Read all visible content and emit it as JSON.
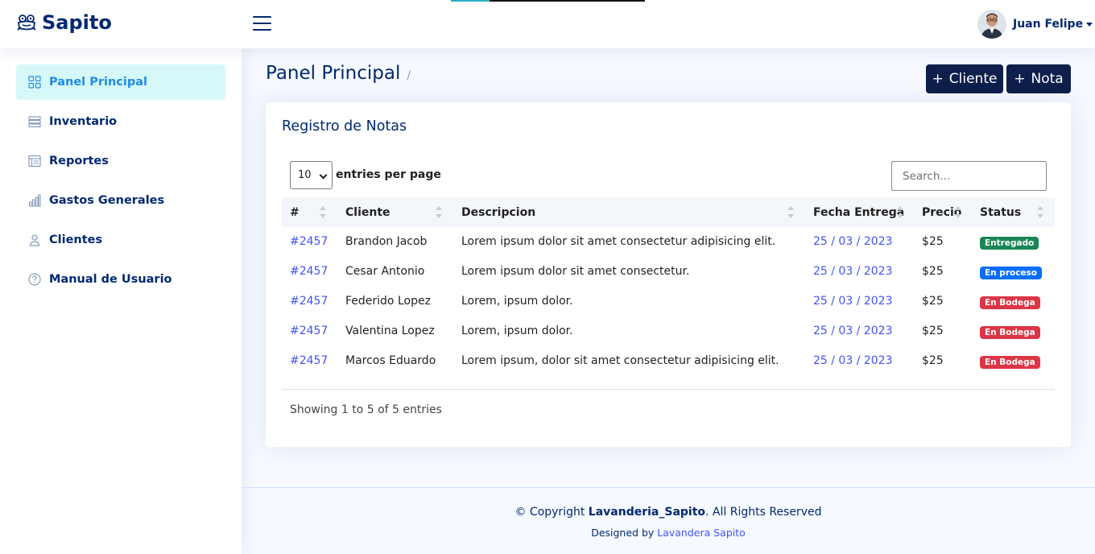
{
  "header": {
    "brand": "Sapito",
    "user_name": "Juan Felipe"
  },
  "sidebar": {
    "items": [
      {
        "label": "Panel Principal",
        "icon": "grid-icon",
        "active": true
      },
      {
        "label": "Inventario",
        "icon": "inventory-icon",
        "active": false
      },
      {
        "label": "Reportes",
        "icon": "report-icon",
        "active": false
      },
      {
        "label": "Gastos Generales",
        "icon": "bar-chart-icon",
        "active": false
      },
      {
        "label": "Clientes",
        "icon": "person-icon",
        "active": false
      },
      {
        "label": "Manual de Usuario",
        "icon": "question-circle-icon",
        "active": false
      }
    ]
  },
  "page": {
    "title": "Panel Principal",
    "breadcrumb_sep": "/",
    "btn_cliente": "Cliente",
    "btn_nota": "Nota",
    "btn_plus": "+"
  },
  "card": {
    "title": "Registro de Notas",
    "per_page_value": "10",
    "per_page_label": "entries per page",
    "search_placeholder": "Search...",
    "showing": "Showing 1 to 5 of 5 entries"
  },
  "table": {
    "columns": [
      "#",
      "Cliente",
      "Descripcion",
      "Fecha Entrega",
      "Precio",
      "Status"
    ],
    "rows": [
      {
        "id": "#2457",
        "cliente": "Brandon Jacob",
        "descripcion": "Lorem ipsum dolor sit amet consectetur adipisicing elit.",
        "fecha": "25 / 03 / 2023",
        "precio": "$25",
        "status": "Entregado",
        "status_color": "#198754"
      },
      {
        "id": "#2457",
        "cliente": "Cesar Antonio",
        "descripcion": "Lorem ipsum dolor sit amet consectetur.",
        "fecha": "25 / 03 / 2023",
        "precio": "$25",
        "status": "En proceso",
        "status_color": "#0d6efd"
      },
      {
        "id": "#2457",
        "cliente": "Federido Lopez",
        "descripcion": "Lorem, ipsum dolor.",
        "fecha": "25 / 03 / 2023",
        "precio": "$25",
        "status": "En Bodega",
        "status_color": "#dc3545"
      },
      {
        "id": "#2457",
        "cliente": "Valentina Lopez",
        "descripcion": "Lorem, ipsum dolor.",
        "fecha": "25 / 03 / 2023",
        "precio": "$25",
        "status": "En Bodega",
        "status_color": "#dc3545"
      },
      {
        "id": "#2457",
        "cliente": "Marcos Eduardo",
        "descripcion": "Lorem ipsum, dolor sit amet consectetur adipisicing elit.",
        "fecha": "25 / 03 / 2023",
        "precio": "$25",
        "status": "En Bodega",
        "status_color": "#dc3545"
      }
    ]
  },
  "footer": {
    "copyright_prefix": "© Copyright ",
    "copyright_brand": "Lavanderia_Sapito",
    "copyright_suffix": ". All Rights Reserved",
    "designed_by": "Designed by ",
    "designer": "Lavandera Sapito"
  },
  "colors": {
    "brand": "#012970",
    "accent": "#4154f1",
    "button": "#0f1f4b",
    "active_bg": "#d7f8f8"
  }
}
